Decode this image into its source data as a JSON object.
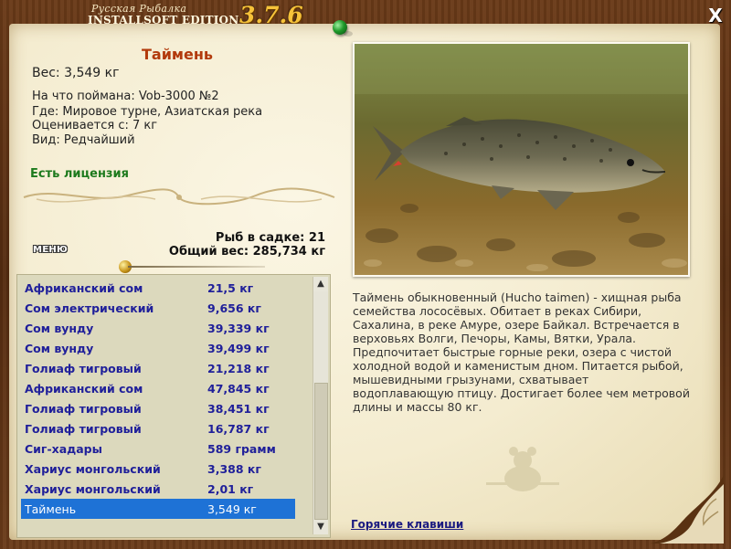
{
  "app": {
    "brand_top": "Русская Рыбалка",
    "brand_bottom": "INSTALLSOFT EDITION",
    "version": "3.7.6",
    "close_glyph": "X"
  },
  "fish": {
    "title": "Таймень",
    "weight": "Вес: 3,549 кг",
    "caught_with": "На что поймана: Vob-3000 №2",
    "where": "Где: Мировое турне, Азиатская река",
    "valued_from": "Оценивается с: 7 кг",
    "kind": "Вид: Редчайший",
    "license": "Есть лицензия",
    "description": "Таймень обыкновенный (Hucho taimen) - хищная рыба семейства лососёвых. Обитает в реках Сибири, Сахалина, в реке Амуре, озере Байкал. Встречается в верховьях Волги, Печоры, Камы, Вятки, Урала. Предпочитает быстрые горные реки, озера с чистой холодной водой и каменистым дном. Питается рыбой, мышевидными грызунами, схватывает водоплавающую птицу. Достигает более чем метровой длины и массы 80 кг."
  },
  "stats": {
    "in_keepnet": "Рыб в садке: 21",
    "total_weight": "Общий вес: 285,734 кг"
  },
  "menu_label": "МЕНЮ",
  "catch_list": [
    {
      "name": "Африканский сом",
      "weight": "21,5 кг"
    },
    {
      "name": "Сом электрический",
      "weight": "9,656 кг"
    },
    {
      "name": "Сом вунду",
      "weight": "39,339 кг"
    },
    {
      "name": "Сом вунду",
      "weight": "39,499 кг"
    },
    {
      "name": "Голиаф тигровый",
      "weight": "21,218 кг"
    },
    {
      "name": "Африканский сом",
      "weight": "47,845 кг"
    },
    {
      "name": "Голиаф тигровый",
      "weight": "38,451 кг"
    },
    {
      "name": "Голиаф тигровый",
      "weight": "16,787 кг"
    },
    {
      "name": "Сиг-хадары",
      "weight": "589 грамм"
    },
    {
      "name": "Хариус монгольский",
      "weight": "3,388 кг"
    },
    {
      "name": "Хариус монгольский",
      "weight": "2,01 кг"
    },
    {
      "name": "Таймень",
      "weight": "3,549 кг",
      "selected": true
    }
  ],
  "hotkeys": "Горячие клавиши",
  "colors": {
    "title": "#b23a0c",
    "license": "#1d7a1d",
    "list_text": "#20209a",
    "selection": "#1e72d6",
    "version": "#f6c23a"
  },
  "icons": {
    "close": "close-icon",
    "scroll_up": "chevron-up-icon",
    "scroll_down": "chevron-down-icon",
    "pin": "pushpin-icon"
  }
}
